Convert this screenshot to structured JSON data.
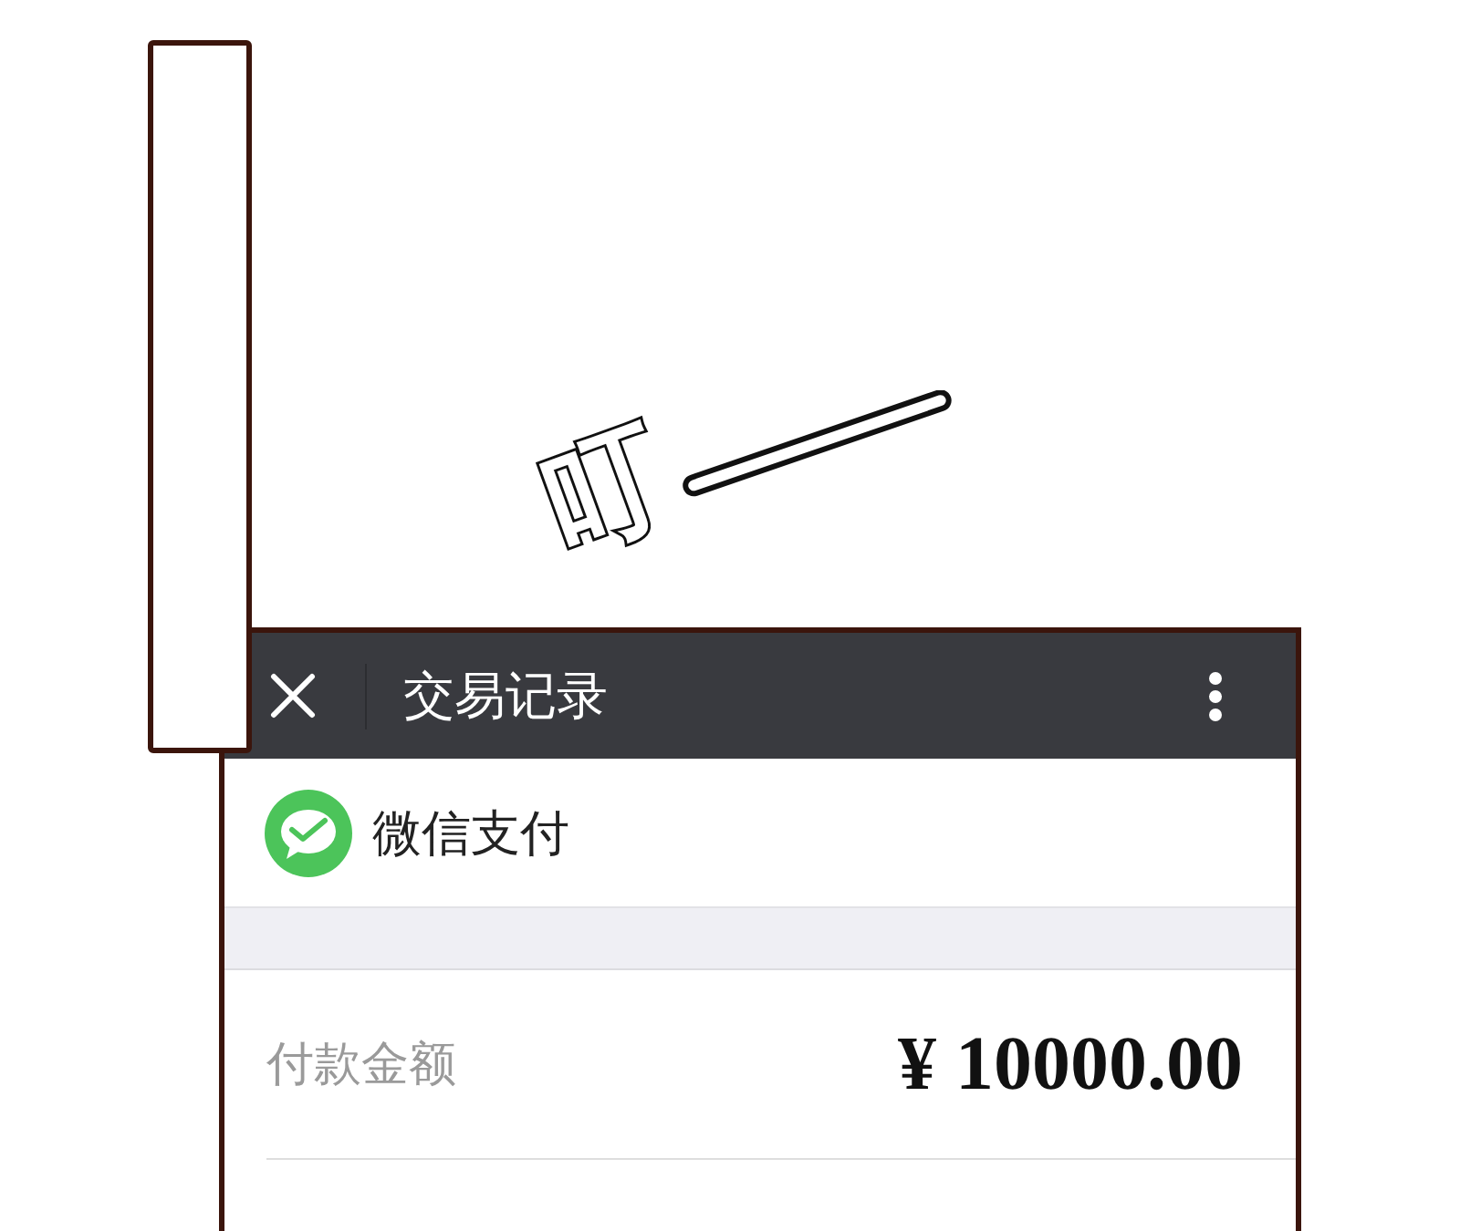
{
  "sound_effect": {
    "text": "叮"
  },
  "header": {
    "title": "交易记录"
  },
  "merchant": {
    "name": "微信支付"
  },
  "details": [
    {
      "label": "付款金额",
      "value": "¥ 10000.00"
    }
  ]
}
